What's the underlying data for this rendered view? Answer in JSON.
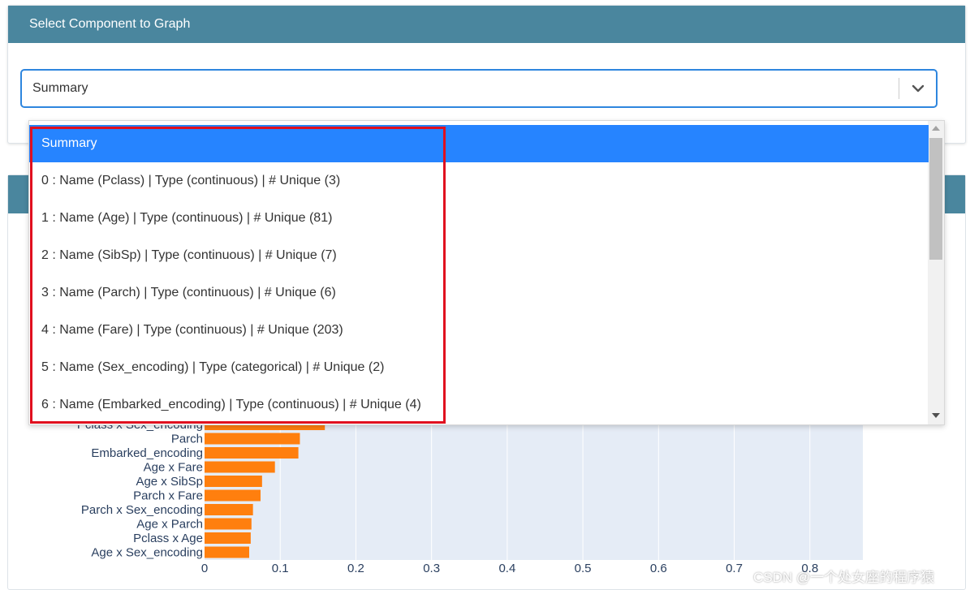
{
  "top_card": {
    "title": "Select Component to Graph",
    "select_value": "Summary"
  },
  "menu": {
    "items": [
      {
        "label": "Summary",
        "selected": true
      },
      {
        "label": "0 : Name (Pclass) | Type (continuous) | # Unique (3)"
      },
      {
        "label": "1 : Name (Age) | Type (continuous) | # Unique (81)"
      },
      {
        "label": "2 : Name (SibSp) | Type (continuous) | # Unique (7)"
      },
      {
        "label": "3 : Name (Parch) | Type (continuous) | # Unique (6)"
      },
      {
        "label": "4 : Name (Fare) | Type (continuous) | # Unique (203)"
      },
      {
        "label": "5 : Name (Sex_encoding) | Type (categorical) | # Unique (2)"
      },
      {
        "label": "6 : Name (Embarked_encoding) | Type (continuous) | # Unique (4)"
      }
    ]
  },
  "colors": {
    "header_bg": "#4a869e",
    "selected_bg": "#2684ff",
    "bar": "#ff7f0e",
    "plot_bg": "#e5ecf6",
    "highlight": "#e0101f"
  },
  "chart_data": {
    "type": "bar",
    "orientation": "horizontal",
    "categories": [
      "Pclass x Sex_encoding",
      "Parch",
      "Embarked_encoding",
      "Age x Fare",
      "Age x SibSp",
      "Parch x Fare",
      "Parch x Sex_encoding",
      "Age x Parch",
      "Pclass x Age",
      "Age x Sex_encoding"
    ],
    "values": [
      0.159,
      0.126,
      0.124,
      0.093,
      0.076,
      0.074,
      0.064,
      0.062,
      0.061,
      0.059
    ],
    "x_ticks": [
      "0",
      "0.1",
      "0.2",
      "0.3",
      "0.4",
      "0.5",
      "0.6",
      "0.7",
      "0.8"
    ],
    "xlim": [
      0,
      0.87
    ],
    "grid": true
  },
  "watermark": "CSDN @一个处女座的程序猿"
}
